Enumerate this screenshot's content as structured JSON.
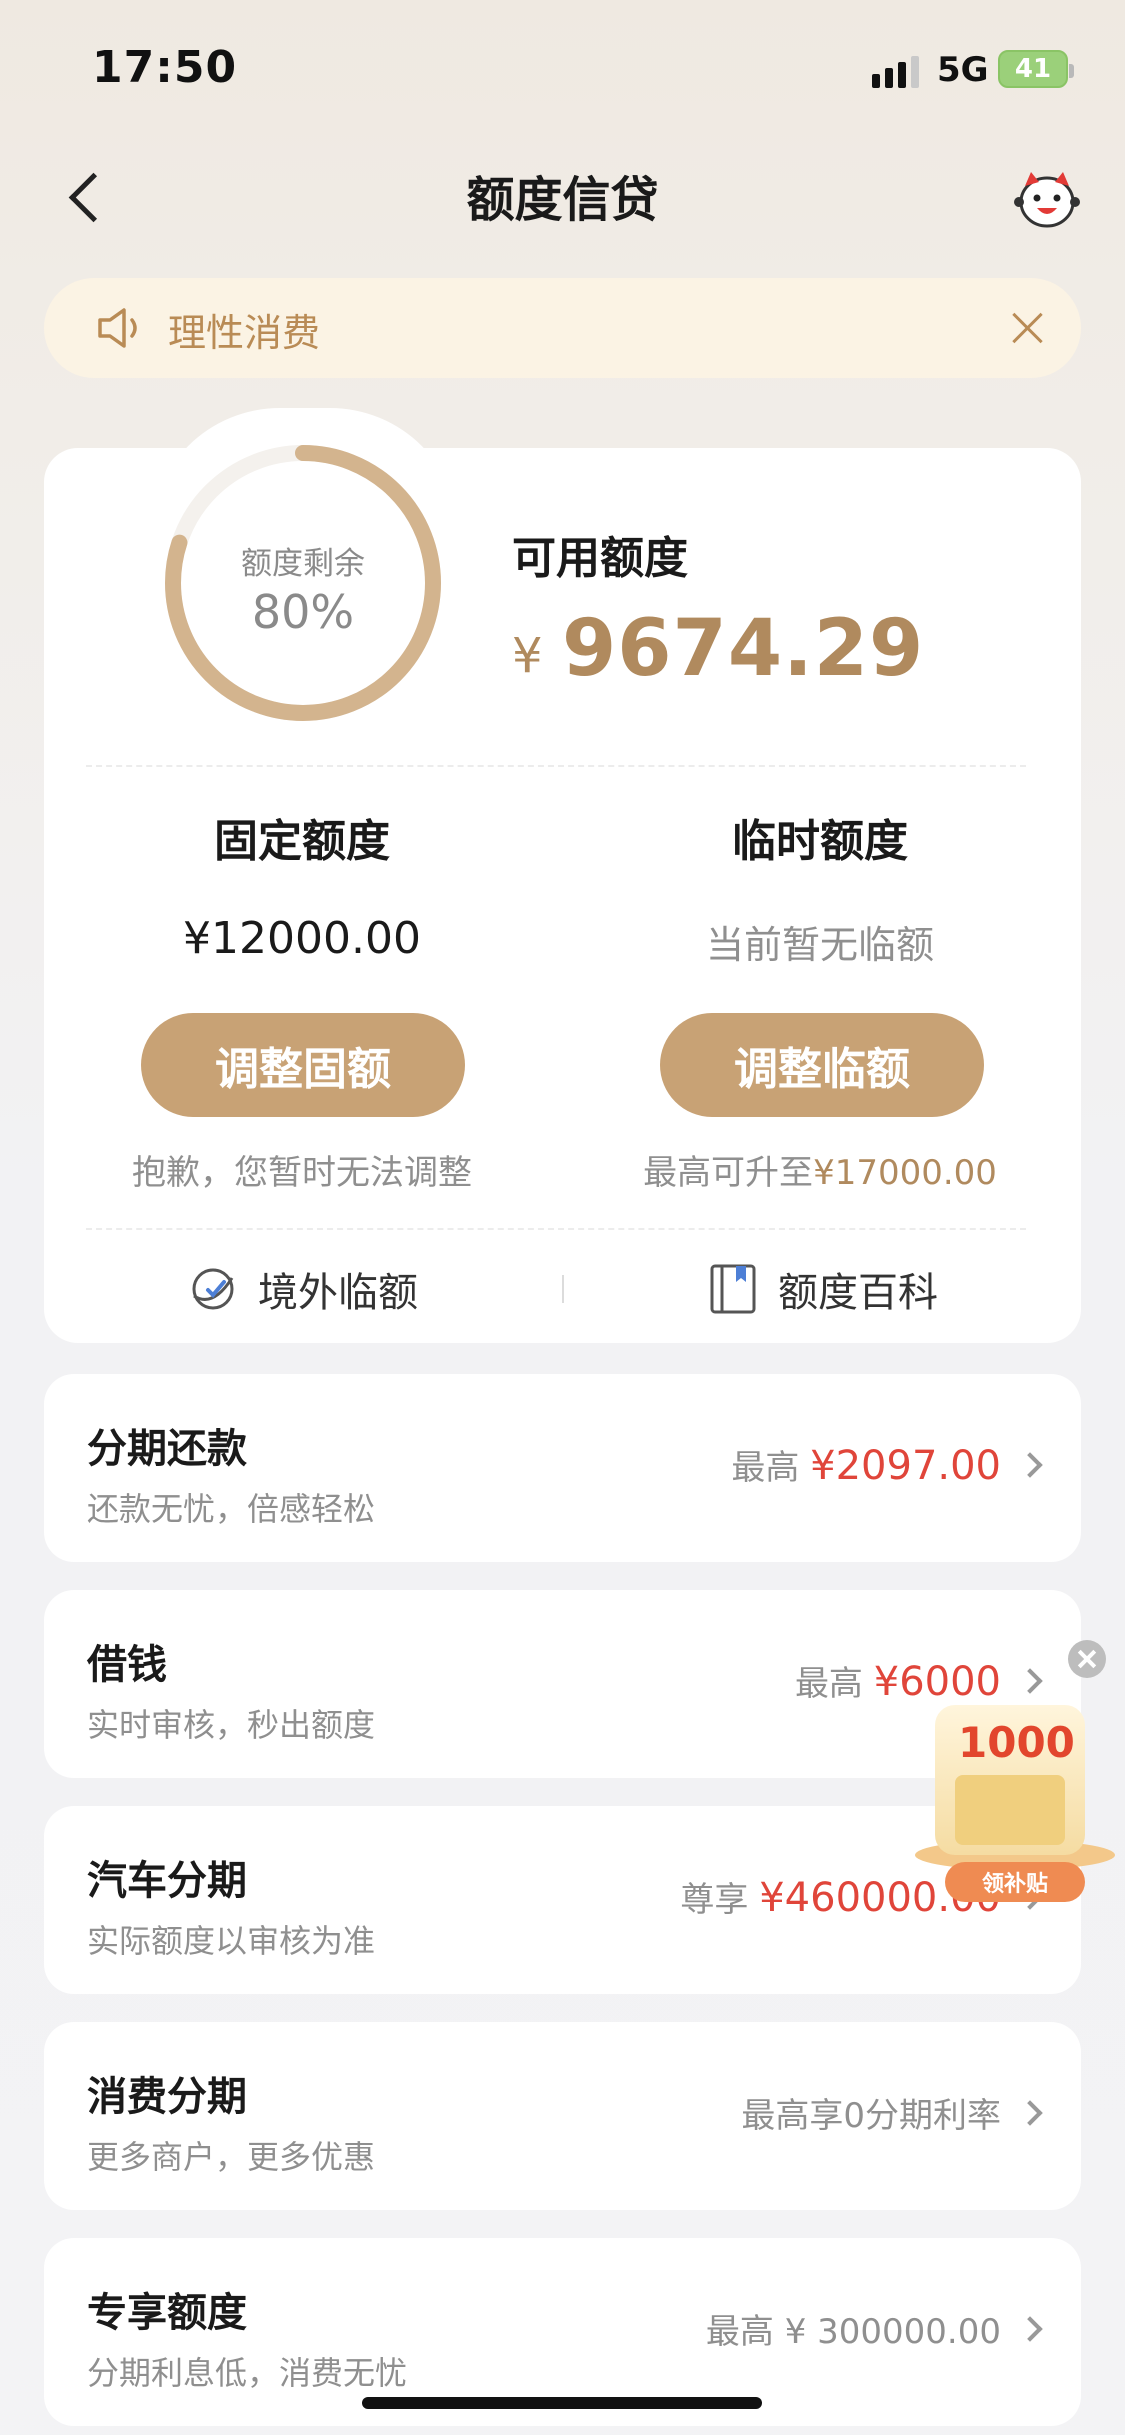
{
  "status_bar": {
    "time": "17:50",
    "network": "5G",
    "battery": "41"
  },
  "nav": {
    "title": "额度信贷"
  },
  "notice": {
    "text": "理性消费"
  },
  "quota": {
    "ring_label": "额度剩余",
    "ring_percent": "80%",
    "ring_fraction": 0.8,
    "available_label": "可用额度",
    "currency": "¥",
    "available_value": "9674.29",
    "fixed": {
      "title": "固定额度",
      "value": "¥12000.00",
      "button": "调整固额",
      "note": "抱歉，您暂时无法调整"
    },
    "temp": {
      "title": "临时额度",
      "value": "当前暂无临额",
      "button": "调整临额",
      "note_prefix": "最高可升至",
      "note_amount": "¥17000.00"
    },
    "links": {
      "overseas": "境外临额",
      "encyclopedia": "额度百科"
    }
  },
  "list": [
    {
      "title": "分期还款",
      "subtitle": "还款无忧，倍感轻松",
      "prefix": "最高",
      "amount": "¥2097.00"
    },
    {
      "title": "借钱",
      "subtitle": "实时审核，秒出额度",
      "prefix": "最高",
      "amount": "¥6000"
    },
    {
      "title": "汽车分期",
      "subtitle": "实际额度以审核为准",
      "prefix": "尊享",
      "amount": "¥460000.00"
    },
    {
      "title": "消费分期",
      "subtitle": "更多商户，更多优惠",
      "prefix": "最高享0分期利率",
      "amount": ""
    },
    {
      "title": "专享额度",
      "subtitle": "分期利息低，消费无忧",
      "prefix": "最高 ¥ 300000.00",
      "amount": ""
    }
  ],
  "float_ad": {
    "amount": "1000",
    "tag": "领补贴"
  },
  "colors": {
    "gold": "#b08a5e",
    "button": "#c8a275",
    "red": "#e0453a"
  }
}
